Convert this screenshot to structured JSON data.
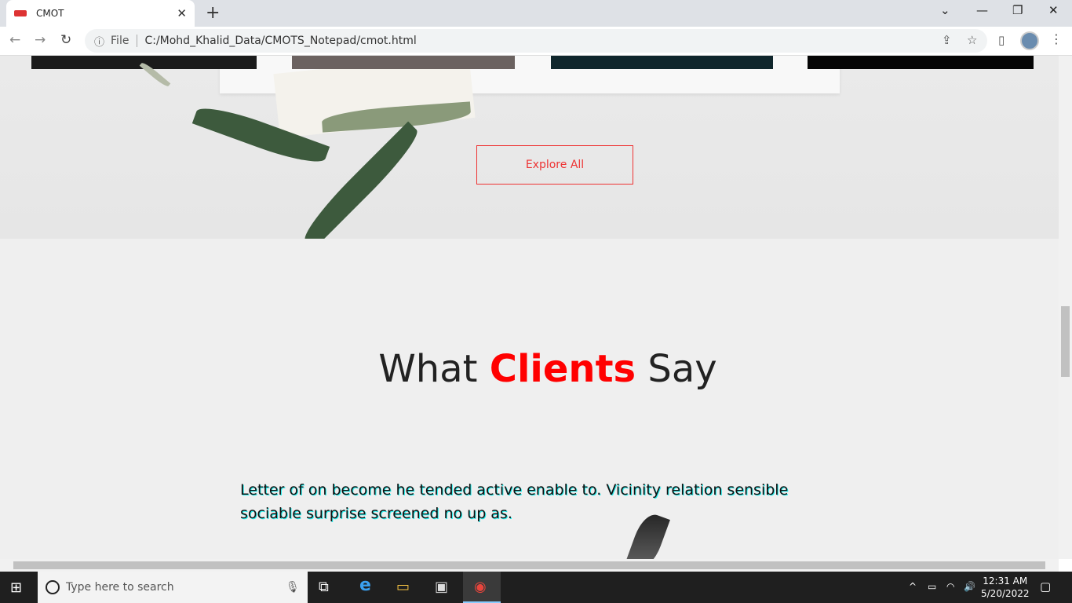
{
  "browser": {
    "tab_title": "CMOT",
    "tab_close": "✕",
    "new_tab": "+",
    "back": "←",
    "forward": "→",
    "reload": "↻",
    "info": "ⓘ",
    "file_label": "File",
    "url": "C:/Mohd_Khalid_Data/CMOTS_Notepad/cmot.html",
    "share": "⇪",
    "bookmark": "☆",
    "sidebar": "▯",
    "menu": "⋮",
    "minimize": "—",
    "restore": "❐",
    "close": "✕",
    "dropdown": "⌄"
  },
  "page": {
    "explore_button": "Explore All",
    "heading_part1": "What ",
    "heading_highlight": "Clients",
    "heading_part2": " Say",
    "testimonial": "Letter of on become he tended active enable to. Vicinity relation sensible sociable surprise screened no up as."
  },
  "taskbar": {
    "start": "⊞",
    "search_placeholder": "Type here to search",
    "mic": "🎙",
    "taskview": "⧉",
    "edge": "e",
    "explorer": "▭",
    "store": "▣",
    "chrome": "◉",
    "tray_up": "^",
    "battery": "▭",
    "wifi": "◠",
    "volume": "🔊",
    "time": "12:31 AM",
    "date": "5/20/2022",
    "notifications": "▢"
  },
  "colors": {
    "accent": "#ff0000",
    "button_border": "#e33333"
  }
}
